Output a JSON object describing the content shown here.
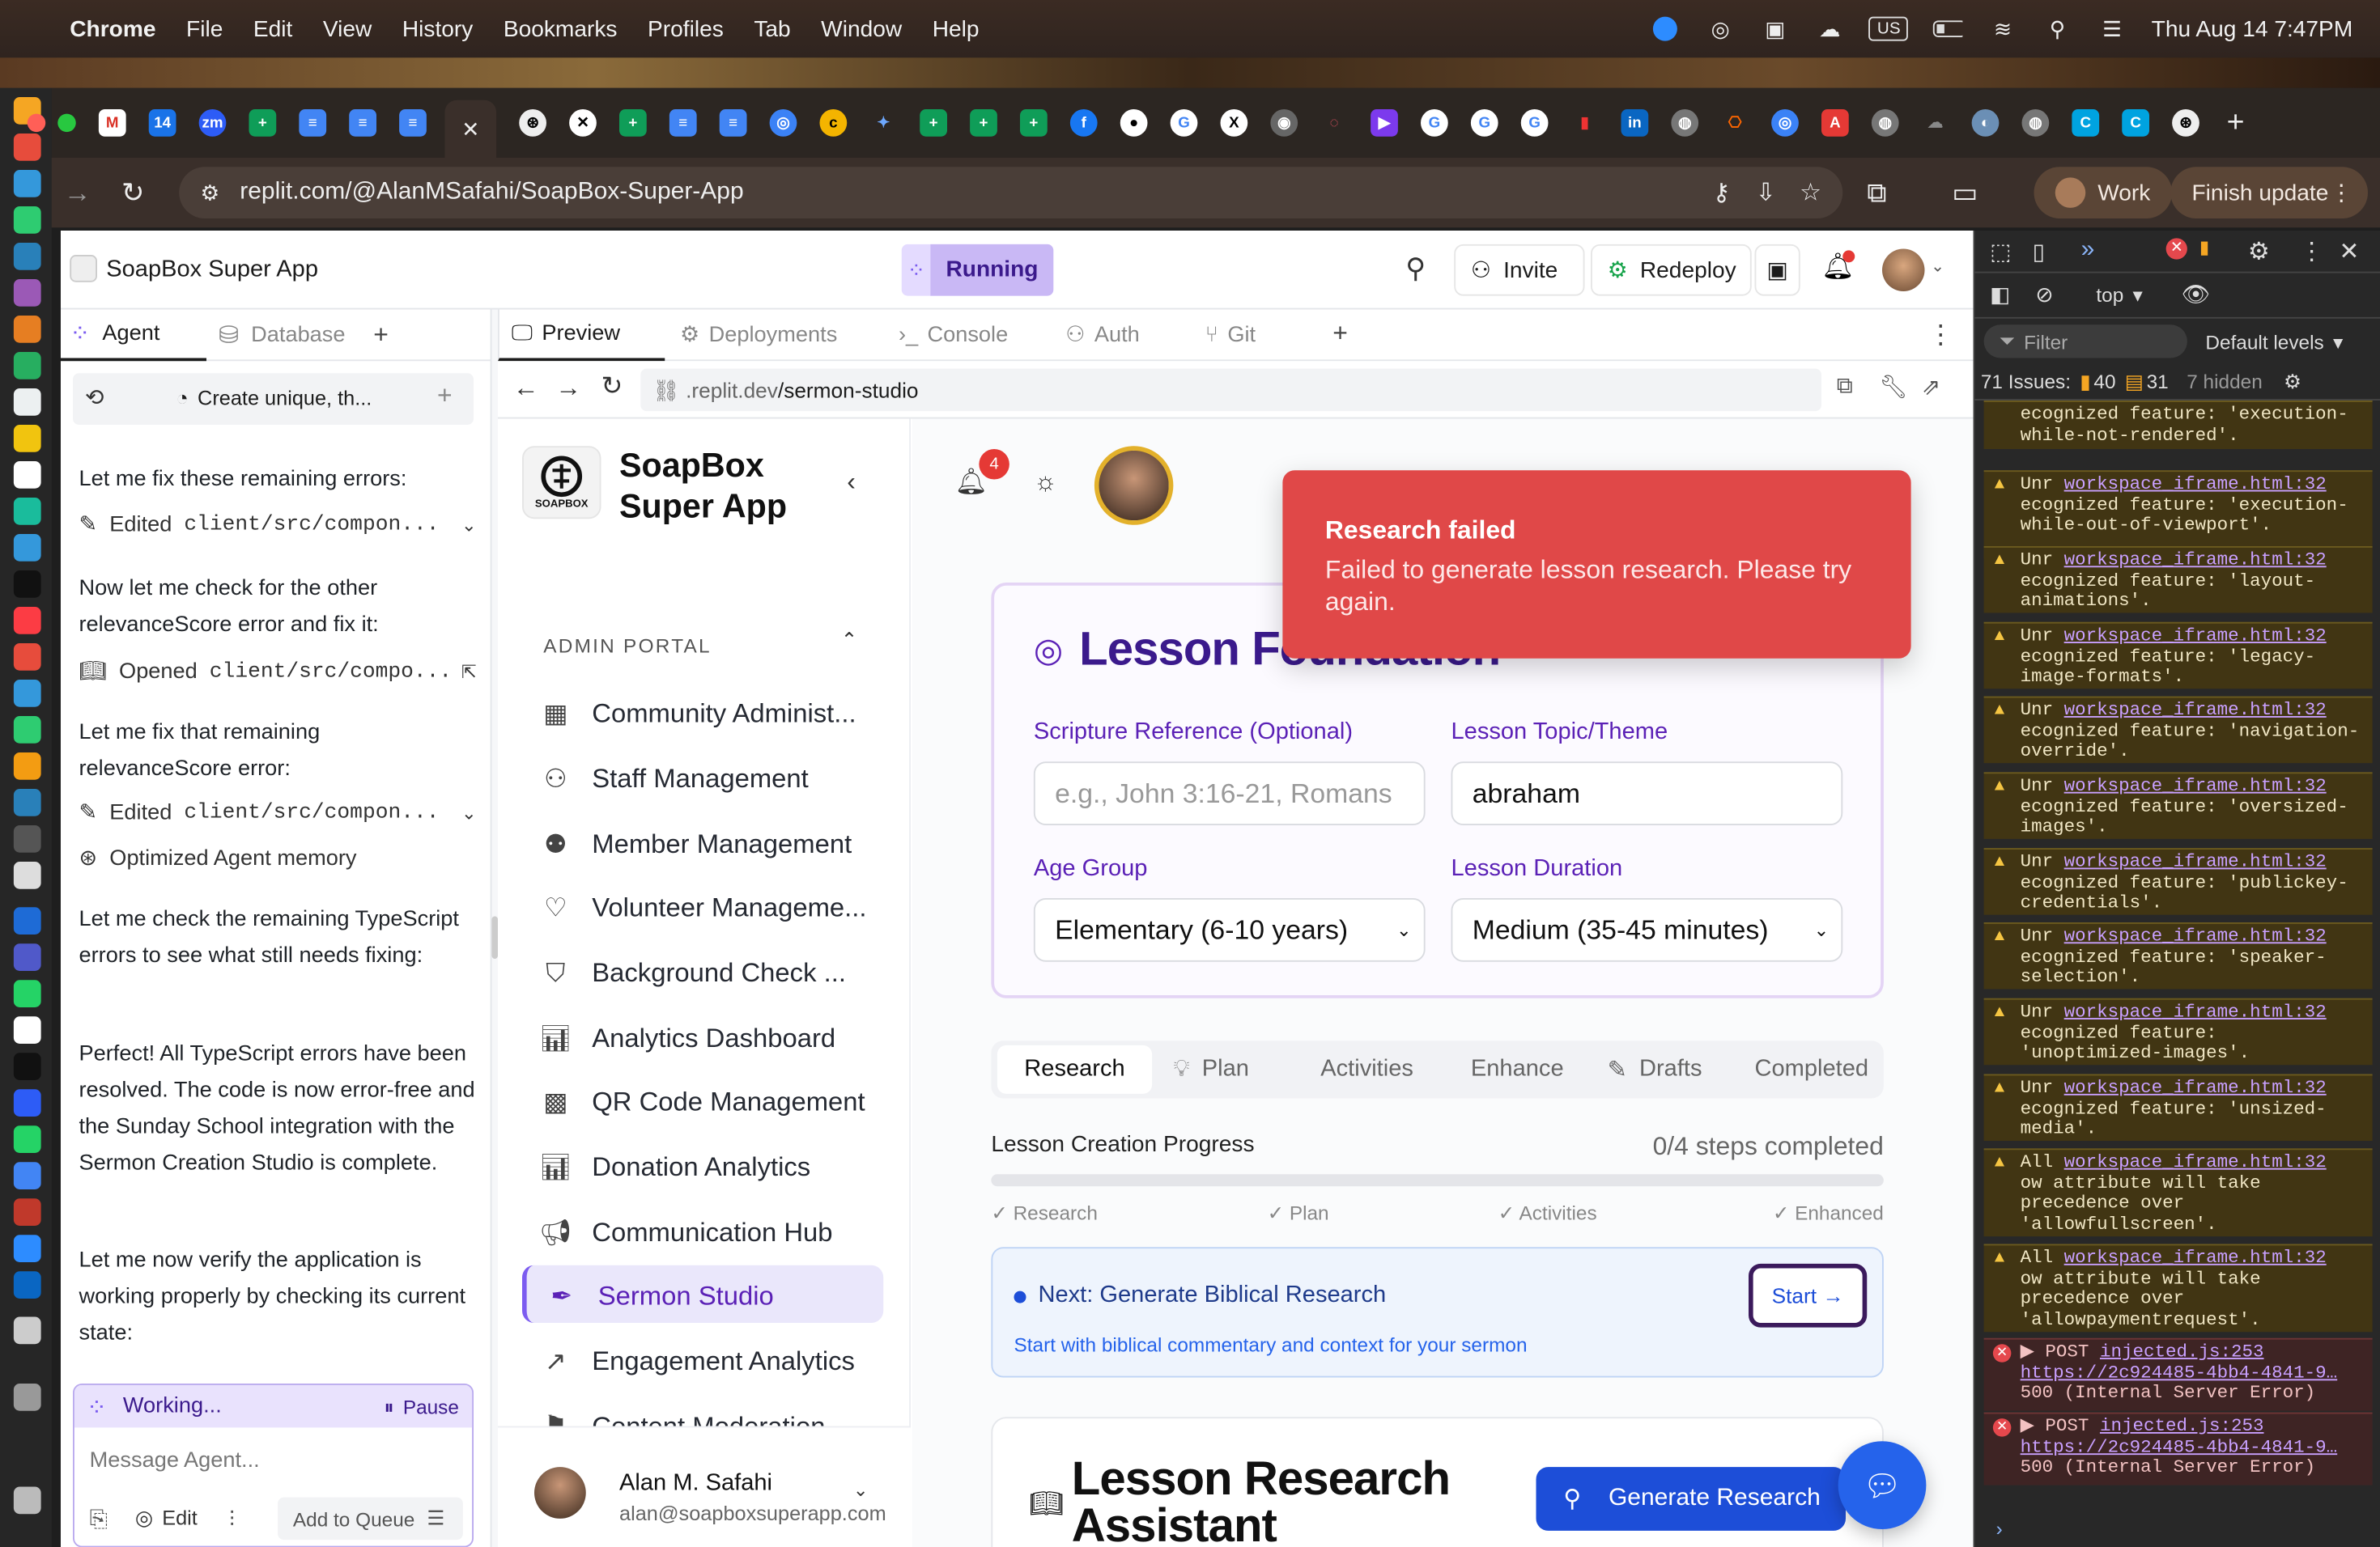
{
  "menubar": {
    "app": "Chrome",
    "items": [
      "File",
      "Edit",
      "View",
      "History",
      "Bookmarks",
      "Profiles",
      "Tab",
      "Window",
      "Help"
    ],
    "clock": "Thu Aug 14  7:47PM",
    "input_source": "US"
  },
  "browser": {
    "url": "replit.com/@AlanMSafahi/SoapBox-Super-App",
    "profile_label": "Work",
    "update_label": "Finish update",
    "new_tab": "+"
  },
  "replit": {
    "project_name": "SoapBox Super App",
    "status": "Running",
    "invite_label": "Invite",
    "redeploy_label": "Redeploy",
    "left_tabs": [
      "Agent",
      "Database"
    ],
    "history_title": "Create unique, th...",
    "preview_tabs": [
      "Preview",
      "Deployments",
      "Console",
      "Auth",
      "Git"
    ],
    "preview_url_prefix": ".replit.dev",
    "preview_url_path": "/sermon-studio"
  },
  "agent": {
    "messages": [
      "Let me fix these remaining errors:",
      "Now let me check for the other relevanceScore error and fix it:",
      "Let me fix that remaining relevanceScore error:",
      "Let me check the remaining TypeScript errors to see what still needs fixing:",
      "Perfect! All TypeScript errors have been resolved. The code is now error-free and the Sunday School integration with the Sermon Creation Studio is complete.",
      "Let me now verify the application is working properly by checking its current state:"
    ],
    "tool1_verb": "Edited",
    "tool1_path": "client/src/compon...",
    "tool2_verb": "Opened",
    "tool2_path": "client/src/compo...",
    "tool3_verb": "Edited",
    "tool3_path": "client/src/compon...",
    "memory": "Optimized Agent memory",
    "working": "Working...",
    "pause": "Pause",
    "placeholder": "Message Agent...",
    "edit": "Edit",
    "queue": "Add to Queue"
  },
  "site": {
    "brand_line1": "SoapBox",
    "brand_line2": "Super App",
    "logo_text": "SOAPBOX",
    "section": "ADMIN PORTAL",
    "nav": [
      {
        "label": "Community Administ...",
        "icon": "building-icon"
      },
      {
        "label": "Staff Management",
        "icon": "user-gear-icon"
      },
      {
        "label": "Member Management",
        "icon": "users-icon"
      },
      {
        "label": "Volunteer Manageme...",
        "icon": "hand-heart-icon"
      },
      {
        "label": "Background Check ...",
        "icon": "shield-icon"
      },
      {
        "label": "Analytics Dashboard",
        "icon": "bar-chart-icon"
      },
      {
        "label": "QR Code Management",
        "icon": "qr-code-icon"
      },
      {
        "label": "Donation Analytics",
        "icon": "bar-chart-icon"
      },
      {
        "label": "Communication Hub",
        "icon": "megaphone-icon"
      },
      {
        "label": "Sermon Studio",
        "icon": "pen-icon"
      },
      {
        "label": "Engagement Analytics",
        "icon": "trend-icon"
      },
      {
        "label": "Content Moderation",
        "icon": "flag-icon"
      }
    ],
    "user_name": "Alan M. Safahi",
    "user_email": "alan@soapboxsuperapp.com",
    "notif_count": "4"
  },
  "lesson": {
    "title": "Lesson Foundation",
    "scripture_label": "Scripture Reference (Optional)",
    "scripture_placeholder": "e.g., John 3:16-21, Romans",
    "topic_label": "Lesson Topic/Theme",
    "topic_value": "abraham",
    "age_label": "Age Group",
    "age_value": "Elementary (6-10 years)",
    "duration_label": "Lesson Duration",
    "duration_value": "Medium (35-45 minutes)",
    "tabs": [
      "Research",
      "Plan",
      "Activities",
      "Enhance",
      "Drafts",
      "Completed"
    ],
    "progress_label": "Lesson Creation Progress",
    "progress_status": "0/4 steps completed",
    "progress_fraction": 0,
    "steps": [
      "✓ Research",
      "✓ Plan",
      "✓ Activities",
      "✓ Enhanced"
    ],
    "next_title": "Next: Generate Biblical Research",
    "next_desc": "Start with biblical commentary and context for your sermon",
    "start_label": "Start →",
    "research_title": "Lesson Research Assistant",
    "generate_label": "Generate Research"
  },
  "toast": {
    "title": "Research failed",
    "message": "Failed to generate lesson research. Please try again."
  },
  "devtools": {
    "context": "top",
    "filter": "Filter",
    "levels": "Default levels",
    "issues_label": "71 Issues:",
    "issues_warn": "40",
    "issues_info": "31",
    "hidden": "7 hidden",
    "top_fragment": "ecognized feature: 'execution-while-not-rendered'.",
    "warnings": [
      {
        "prefix": "Unr",
        "src": "workspace_iframe.html:32",
        "text": "ecognized feature: 'execution-while-out-of-viewport'."
      },
      {
        "prefix": "Unr",
        "src": "workspace_iframe.html:32",
        "text": "ecognized feature: 'layout-animations'."
      },
      {
        "prefix": "Unr",
        "src": "workspace_iframe.html:32",
        "text": "ecognized feature: 'legacy-image-formats'."
      },
      {
        "prefix": "Unr",
        "src": "workspace_iframe.html:32",
        "text": "ecognized feature: 'navigation-override'."
      },
      {
        "prefix": "Unr",
        "src": "workspace_iframe.html:32",
        "text": "ecognized feature: 'oversized-images'."
      },
      {
        "prefix": "Unr",
        "src": "workspace_iframe.html:32",
        "text": "ecognized feature: 'publickey-credentials'."
      },
      {
        "prefix": "Unr",
        "src": "workspace_iframe.html:32",
        "text": "ecognized feature: 'speaker-selection'."
      },
      {
        "prefix": "Unr",
        "src": "workspace_iframe.html:32",
        "text": "ecognized feature: 'unoptimized-images'."
      },
      {
        "prefix": "Unr",
        "src": "workspace_iframe.html:32",
        "text": "ecognized feature: 'unsized-media'."
      },
      {
        "prefix": "All",
        "src": "workspace_iframe.html:32",
        "text": "ow attribute will take precedence over 'allowfullscreen'."
      },
      {
        "prefix": "All",
        "src": "workspace_iframe.html:32",
        "text": "ow attribute will take precedence over 'allowpaymentrequest'."
      }
    ],
    "errors": [
      {
        "method": "▶ POST",
        "src": "injected.js:253",
        "url": "https://2c924485-4bb4-4841-9…",
        "status": "500 (Internal Server Error)"
      },
      {
        "method": "▶ POST",
        "src": "injected.js:253",
        "url": "https://2c924485-4bb4-4841-9…",
        "status": "500 (Internal Server Error)"
      }
    ]
  },
  "colors": {
    "accent": "#5b21b6",
    "brand_blue": "#1d4ed8",
    "toast_red": "#e04848",
    "running_bg": "#c9b8f5"
  }
}
